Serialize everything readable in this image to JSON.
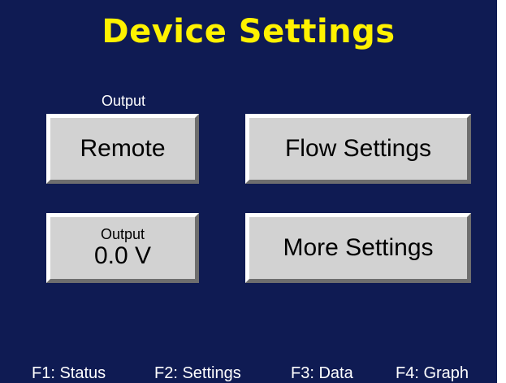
{
  "header": {
    "title": "Device Settings"
  },
  "buttons": {
    "output_caption": "Output",
    "remote_label": "Remote",
    "flow_settings_label": "Flow Settings",
    "output_value_caption": "Output",
    "output_value": "0.0 V",
    "more_settings_label": "More Settings"
  },
  "footer": {
    "keys": [
      {
        "label": "F1: Status"
      },
      {
        "label": "F2: Settings"
      },
      {
        "label": "F3: Data"
      },
      {
        "label": "F4: Graph"
      }
    ]
  },
  "colors": {
    "background": "#0f1b53",
    "title": "#fff200",
    "button_face": "#d2d2d2",
    "text_light": "#ffffff"
  }
}
